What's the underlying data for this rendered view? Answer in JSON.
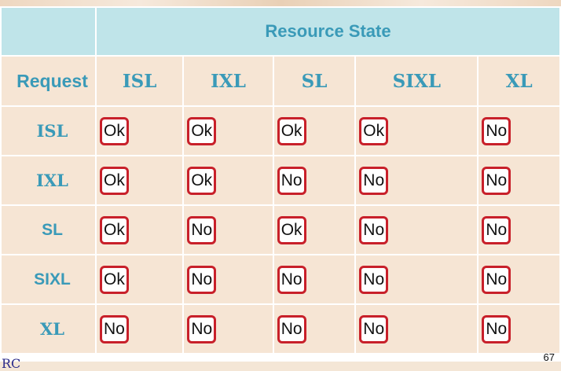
{
  "header": {
    "resource_state": "Resource State",
    "request": "Request"
  },
  "columns": [
    "ISL",
    "IXL",
    "SL",
    "SIXL",
    "XL"
  ],
  "rows": [
    {
      "label": "ISL",
      "values": [
        "Ok",
        "Ok",
        "Ok",
        "Ok",
        "No"
      ]
    },
    {
      "label": "IXL",
      "values": [
        "Ok",
        "Ok",
        "No",
        "No",
        "No"
      ]
    },
    {
      "label": "SL",
      "values": [
        "Ok",
        "No",
        "Ok",
        "No",
        "No"
      ]
    },
    {
      "label": "SIXL",
      "values": [
        "Ok",
        "No",
        "No",
        "No",
        "No"
      ]
    },
    {
      "label": "XL",
      "values": [
        "No",
        "No",
        "No",
        "No",
        "No"
      ]
    }
  ],
  "footer": {
    "page_number": "67",
    "logo_text": "RC"
  },
  "colors": {
    "header_teal": "#bfe4e9",
    "label_blue": "#3a9ab8",
    "cell_bg": "#f6e5d4",
    "badge_border": "#c8202a"
  }
}
